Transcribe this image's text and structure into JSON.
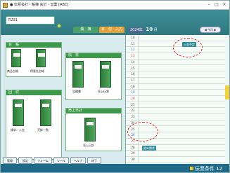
{
  "window": {
    "title": "● 伝票会計・帳簿 会計・営業 [ABC]"
  },
  "search": {
    "value": "R231"
  },
  "modes": {
    "tab_a": "帳　簿",
    "tab_b": "日　付　入力"
  },
  "date": {
    "year": "2024年",
    "month": "10",
    "suffix": "月"
  },
  "nav": {
    "label": "◀ 今月 ▶"
  },
  "groups": {
    "ledger": {
      "title": "台　帳",
      "items": [
        "商品台帳",
        "得意先台帳"
      ]
    },
    "slips": {
      "title": "伝　票",
      "items": [
        "見積書",
        "売上伝票"
      ]
    },
    "collect": {
      "title": "回　収",
      "items": [
        "請求／入金",
        "売掛一覧"
      ]
    },
    "sales": {
      "title": "売上日計",
      "items": [
        "売上日計"
      ]
    }
  },
  "toolbar": {
    "buttons": [
      "管理",
      "設定",
      "フォーム",
      "ツール",
      "ヘルプ",
      "終了"
    ]
  },
  "calendar": {
    "days": [
      "10",
      "11",
      "12",
      "13",
      "14",
      "15",
      "16",
      "17",
      "18",
      "19",
      "20",
      "21",
      "22",
      "23",
      "24",
      "25",
      "26",
      "27",
      "28",
      "29",
      "30"
    ],
    "events": [
      {
        "day": "11",
        "text": "入金予定"
      },
      {
        "day": "28",
        "text": "締め請求"
      }
    ]
  },
  "footer": {
    "count_label": "伝票条件 12"
  }
}
